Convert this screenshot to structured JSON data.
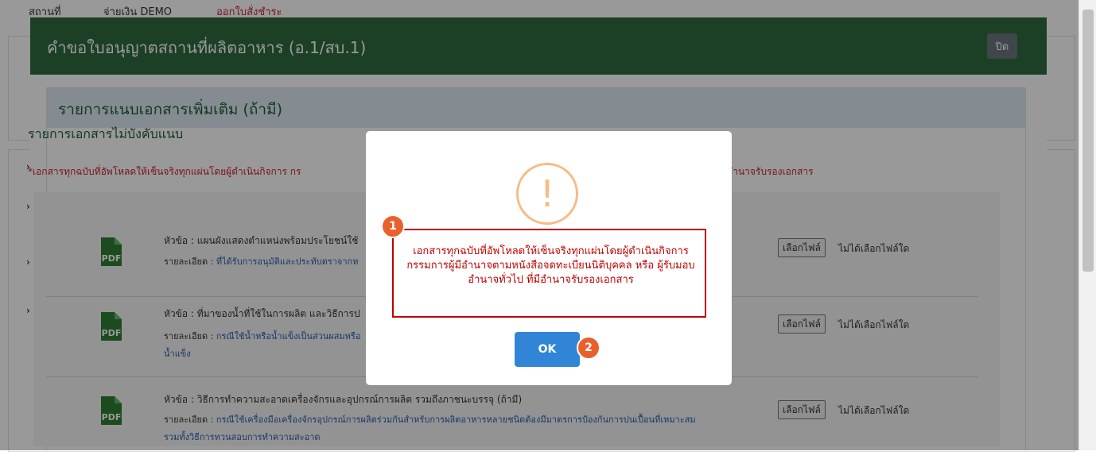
{
  "nav": {
    "item1": "สถานที่",
    "item2": "จ่ายเงิน DEMO",
    "item3": "ออกใบสั่งชำระ"
  },
  "modal": {
    "title": "คำขอใบอนุญาตสถานที่ผลิตอาหาร (อ.1/สบ.1)",
    "close_label": "ปิด",
    "card_title": "รายการแนบเอกสารเพิ่มเติม (ถ้ามี)",
    "section_title": "รายการเอกสารไม่บังคับแนบ",
    "warning_left": "*เอกสารทุกฉบับที่อัพโหลดให้เซ็นจริงทุกแผ่นโดยผู้ดำเนินกิจการ กร",
    "warning_right": "อำนาจรับรองเอกสาร"
  },
  "documents": [
    {
      "topic": "หัวข้อ : แผนผังแสดงตำแหน่งพร้อมประโยชน์ใช้",
      "detail_label": "รายละเอียด :",
      "detail_text": "ที่ได้รับการอนุมัติและประทับตราจากห",
      "detail_text2": "",
      "file_button": "เลือกไฟล์",
      "file_status": "ไม่ได้เลือกไฟล์ใด"
    },
    {
      "topic": "หัวข้อ : ที่มาของน้ำที่ใช้ในการผลิต และวิธีการป",
      "detail_label": "รายละเอียด :",
      "detail_text": "กรณีใช้น้ำหรือน้ำแข็งเป็นส่วนผสมหรือ",
      "detail_text2": "น้ำแข็ง",
      "file_button": "เลือกไฟล์",
      "file_status": "ไม่ได้เลือกไฟล์ใด"
    },
    {
      "topic": "หัวข้อ : วิธีการทำความสะอาดเครื่องจักรและอุปกรณ์การผลิต รวมถึงภาชนะบรรจุ (ถ้ามี)",
      "detail_label": "รายละเอียด :",
      "detail_text": "กรณีใช้เครื่องมือเครื่องจักรอุปกรณ์การผลิตร่วมกันสำหรับการผลิตอาหารหลายชนิดต้องมีมาตรการป้องกันการปนเปื้อนที่เหมาะสม",
      "detail_text2": "รวมทั้งวิธีการทวนสอบการทำความสะอาด",
      "file_button": "เลือกไฟล์",
      "file_status": "ไม่ได้เลือกไฟล์ใด"
    }
  ],
  "alert": {
    "icon_glyph": "!",
    "message": "เอกสารทุกฉบับที่อัพโหลดให้เซ็นจริงทุกแผ่นโดยผู้ดำเนินกิจการ กรรมการผู้มีอำนาจตามหนังสือจดทะเบียนนิติบุคคล หรือ ผู้รับมอบอำนาจทั่วไป ที่มีอำนาจรับรองเอกสาร",
    "ok_label": "OK",
    "badge1": "1",
    "badge2": "2"
  },
  "colors": {
    "header": "#2e6b3f",
    "ok": "#3085d6",
    "warning_icon": "#f8bb86",
    "badge": "#e8612c",
    "error_text": "#c00000"
  }
}
